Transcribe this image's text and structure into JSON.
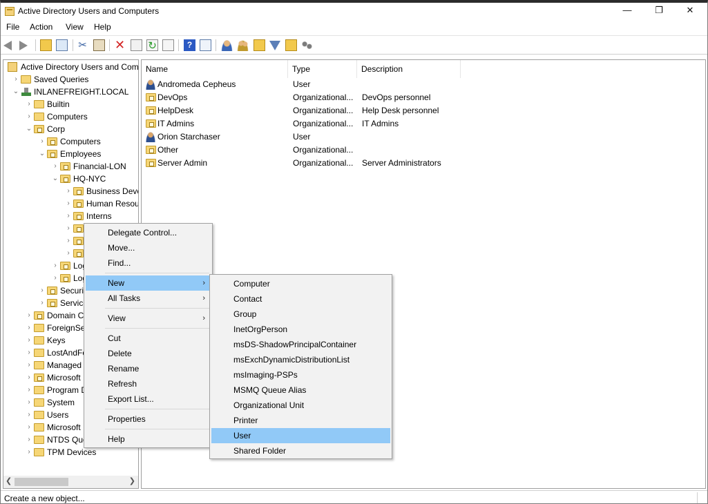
{
  "window": {
    "title": "Active Directory Users and Computers"
  },
  "menu": [
    "File",
    "Action",
    "View",
    "Help"
  ],
  "tree": [
    {
      "label": "Active Directory Users and Com",
      "indent": 0,
      "icon": "root",
      "chevron": ""
    },
    {
      "label": "Saved Queries",
      "indent": 1,
      "icon": "folder",
      "chevron": "›"
    },
    {
      "label": "INLANEFREIGHT.LOCAL",
      "indent": 1,
      "icon": "domain",
      "chevron": "⌄"
    },
    {
      "label": "Builtin",
      "indent": 2,
      "icon": "folder",
      "chevron": "›"
    },
    {
      "label": "Computers",
      "indent": 2,
      "icon": "folder",
      "chevron": "›"
    },
    {
      "label": "Corp",
      "indent": 2,
      "icon": "ou",
      "chevron": "⌄"
    },
    {
      "label": "Computers",
      "indent": 3,
      "icon": "ou",
      "chevron": "›"
    },
    {
      "label": "Employees",
      "indent": 3,
      "icon": "ou",
      "chevron": "⌄"
    },
    {
      "label": "Financial-LON",
      "indent": 4,
      "icon": "ou",
      "chevron": "›"
    },
    {
      "label": "HQ-NYC",
      "indent": 4,
      "icon": "ou",
      "chevron": "⌄"
    },
    {
      "label": "Business Deve",
      "indent": 5,
      "icon": "ou",
      "chevron": "›"
    },
    {
      "label": "Human Resou",
      "indent": 5,
      "icon": "ou",
      "chevron": "›"
    },
    {
      "label": "Interns",
      "indent": 5,
      "icon": "ou",
      "chevron": "›"
    },
    {
      "label": "",
      "indent": 5,
      "icon": "ou",
      "chevron": "›"
    },
    {
      "label": "",
      "indent": 5,
      "icon": "ou",
      "chevron": "›"
    },
    {
      "label": "",
      "indent": 5,
      "icon": "ou",
      "chevron": "›"
    },
    {
      "label": "Log",
      "indent": 4,
      "icon": "ou",
      "chevron": "›"
    },
    {
      "label": "Log",
      "indent": 4,
      "icon": "ou",
      "chevron": "›"
    },
    {
      "label": "Securit",
      "indent": 3,
      "icon": "ou",
      "chevron": "›"
    },
    {
      "label": "Service",
      "indent": 3,
      "icon": "ou",
      "chevron": "›"
    },
    {
      "label": "Domain C",
      "indent": 2,
      "icon": "ou",
      "chevron": "›"
    },
    {
      "label": "ForeignSec",
      "indent": 2,
      "icon": "folder",
      "chevron": "›"
    },
    {
      "label": "Keys",
      "indent": 2,
      "icon": "folder",
      "chevron": "›"
    },
    {
      "label": "LostAndFo",
      "indent": 2,
      "icon": "folder",
      "chevron": "›"
    },
    {
      "label": "Managed",
      "indent": 2,
      "icon": "folder",
      "chevron": "›"
    },
    {
      "label": "Microsoft",
      "indent": 2,
      "icon": "ou",
      "chevron": "›"
    },
    {
      "label": "Program D",
      "indent": 2,
      "icon": "folder",
      "chevron": "›"
    },
    {
      "label": "System",
      "indent": 2,
      "icon": "folder",
      "chevron": "›"
    },
    {
      "label": "Users",
      "indent": 2,
      "icon": "folder",
      "chevron": "›"
    },
    {
      "label": "Microsoft",
      "indent": 2,
      "icon": "folder",
      "chevron": "›"
    },
    {
      "label": "NTDS Quo",
      "indent": 2,
      "icon": "folder",
      "chevron": "›"
    },
    {
      "label": "TPM Devices",
      "indent": 2,
      "icon": "folder",
      "chevron": "›"
    }
  ],
  "list": {
    "columns": [
      "Name",
      "Type",
      "Description"
    ],
    "rows": [
      {
        "name": "Andromeda Cepheus",
        "type": "User",
        "description": "",
        "icon": "user"
      },
      {
        "name": "DevOps",
        "type": "Organizational...",
        "description": "DevOps personnel",
        "icon": "ou"
      },
      {
        "name": "HelpDesk",
        "type": "Organizational...",
        "description": "Help Desk personnel",
        "icon": "ou"
      },
      {
        "name": "IT Admins",
        "type": "Organizational...",
        "description": "IT Admins",
        "icon": "ou"
      },
      {
        "name": "Orion Starchaser",
        "type": "User",
        "description": "",
        "icon": "user"
      },
      {
        "name": "Other",
        "type": "Organizational...",
        "description": "",
        "icon": "ou"
      },
      {
        "name": "Server Admin",
        "type": "Organizational...",
        "description": "Server Administrators",
        "icon": "ou"
      }
    ]
  },
  "context_menu": [
    {
      "label": "Delegate Control...",
      "submenu": false,
      "highlight": false
    },
    {
      "label": "Move...",
      "submenu": false,
      "highlight": false
    },
    {
      "label": "Find...",
      "submenu": false,
      "highlight": false
    },
    {
      "sep": true
    },
    {
      "label": "New",
      "submenu": true,
      "highlight": true
    },
    {
      "label": "All Tasks",
      "submenu": true,
      "highlight": false
    },
    {
      "sep": true
    },
    {
      "label": "View",
      "submenu": true,
      "highlight": false
    },
    {
      "sep": true
    },
    {
      "label": "Cut",
      "submenu": false,
      "highlight": false
    },
    {
      "label": "Delete",
      "submenu": false,
      "highlight": false
    },
    {
      "label": "Rename",
      "submenu": false,
      "highlight": false
    },
    {
      "label": "Refresh",
      "submenu": false,
      "highlight": false
    },
    {
      "label": "Export List...",
      "submenu": false,
      "highlight": false
    },
    {
      "sep": true
    },
    {
      "label": "Properties",
      "submenu": false,
      "highlight": false
    },
    {
      "sep": true
    },
    {
      "label": "Help",
      "submenu": false,
      "highlight": false
    }
  ],
  "new_submenu": [
    {
      "label": "Computer",
      "highlight": false
    },
    {
      "label": "Contact",
      "highlight": false
    },
    {
      "label": "Group",
      "highlight": false
    },
    {
      "label": "InetOrgPerson",
      "highlight": false
    },
    {
      "label": "msDS-ShadowPrincipalContainer",
      "highlight": false
    },
    {
      "label": "msExchDynamicDistributionList",
      "highlight": false
    },
    {
      "label": "msImaging-PSPs",
      "highlight": false
    },
    {
      "label": "MSMQ Queue Alias",
      "highlight": false
    },
    {
      "label": "Organizational Unit",
      "highlight": false
    },
    {
      "label": "Printer",
      "highlight": false
    },
    {
      "label": "User",
      "highlight": true
    },
    {
      "label": "Shared Folder",
      "highlight": false
    }
  ],
  "status": {
    "text": "Create a new object..."
  },
  "colors": {
    "highlight": "#91c9f7",
    "folder": "#f6d676"
  }
}
